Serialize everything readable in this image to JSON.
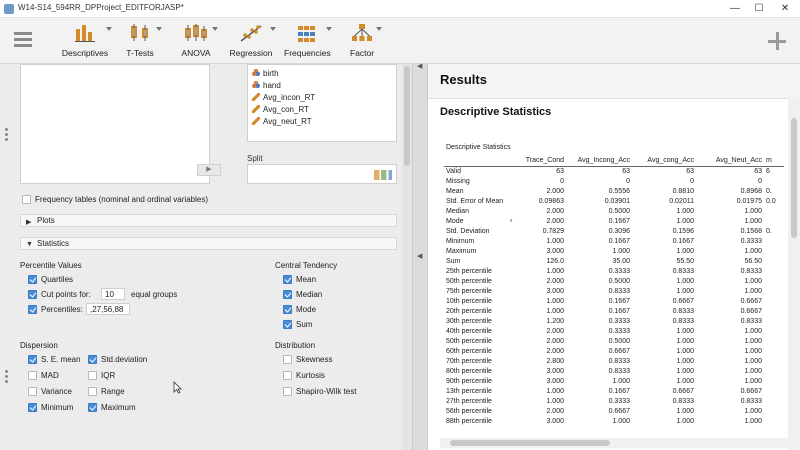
{
  "window": {
    "title": "W14-S14_594RR_DPProject_EDITFORJASP*"
  },
  "ribbon": {
    "buttons": [
      {
        "label": "Descriptives",
        "icon": "descriptives-icon"
      },
      {
        "label": "T-Tests",
        "icon": "t-tests-icon"
      },
      {
        "label": "ANOVA",
        "icon": "anova-icon"
      },
      {
        "label": "Regression",
        "icon": "regression-icon"
      },
      {
        "label": "Frequencies",
        "icon": "frequencies-icon"
      },
      {
        "label": "Factor",
        "icon": "factor-icon"
      }
    ]
  },
  "variables": [
    {
      "name": "birth",
      "type": "nominal"
    },
    {
      "name": "hand",
      "type": "nominal"
    },
    {
      "name": "Avg_incon_RT",
      "type": "scale"
    },
    {
      "name": "Avg_con_RT",
      "type": "scale"
    },
    {
      "name": "Avg_neut_RT",
      "type": "scale"
    }
  ],
  "split_label": "Split",
  "frequency_tables": {
    "label": "Frequency tables (nominal and ordinal variables)",
    "checked": false
  },
  "sections": {
    "plots": "Plots",
    "statistics": "Statistics"
  },
  "percentile_values": {
    "heading": "Percentile Values",
    "quartiles": "Quartiles",
    "cut_points_label": "Cut points for:",
    "cut_points_value": "10",
    "cut_points_suffix": "equal groups",
    "percentiles_label": "Percentiles:",
    "percentiles_value": ",27,56,88"
  },
  "central_tendency": {
    "heading": "Central Tendency",
    "items": [
      "Mean",
      "Median",
      "Mode",
      "Sum"
    ]
  },
  "dispersion": {
    "heading": "Dispersion",
    "col1": [
      {
        "label": "S. E. mean",
        "checked": true
      },
      {
        "label": "MAD",
        "checked": false
      },
      {
        "label": "Variance",
        "checked": false
      },
      {
        "label": "Minimum",
        "checked": true
      }
    ],
    "col2": [
      {
        "label": "Std.deviation",
        "checked": true
      },
      {
        "label": "IQR",
        "checked": false
      },
      {
        "label": "Range",
        "checked": false
      },
      {
        "label": "Maximum",
        "checked": true
      }
    ]
  },
  "distribution": {
    "heading": "Distribution",
    "items": [
      "Skewness",
      "Kurtosis",
      "Shapiro-Wilk test"
    ]
  },
  "results": {
    "heading": "Results",
    "analysis_title": "Descriptive Statistics",
    "table_caption": "Descriptive Statistics",
    "columns": [
      "",
      "Trace_Cond",
      "Avg_Incong_Acc",
      "Avg_cong_Acc",
      "Avg_Neut_Acc",
      "m"
    ],
    "mode_note": "ᵃ",
    "rows": [
      [
        "Valid",
        "63",
        "63",
        "63",
        "63",
        "6"
      ],
      [
        "Missing",
        "0",
        "0",
        "0",
        "0",
        ""
      ],
      [
        "Mean",
        "2.000",
        "0.5556",
        "0.8810",
        "0.8968",
        "0."
      ],
      [
        "Std. Error of Mean",
        "0.09863",
        "0.03901",
        "0.02011",
        "0.01975",
        "0.0"
      ],
      [
        "Median",
        "2.000",
        "0.5000",
        "1.000",
        "1.000",
        ""
      ],
      [
        "Mode",
        "2.000",
        "0.1667",
        "1.000",
        "1.000",
        ""
      ],
      [
        "Std. Deviation",
        "0.7829",
        "0.3096",
        "0.1596",
        "0.1568",
        "0."
      ],
      [
        "Minimum",
        "1.000",
        "0.1667",
        "0.1667",
        "0.3333",
        ""
      ],
      [
        "Maximum",
        "3.000",
        "1.000",
        "1.000",
        "1.000",
        ""
      ],
      [
        "Sum",
        "126.0",
        "35.00",
        "55.50",
        "56.50",
        ""
      ],
      [
        "25th percentile",
        "1.000",
        "0.3333",
        "0.8333",
        "0.8333",
        ""
      ],
      [
        "50th percentile",
        "2.000",
        "0.5000",
        "1.000",
        "1.000",
        ""
      ],
      [
        "75th percentile",
        "3.000",
        "0.8333",
        "1.000",
        "1.000",
        ""
      ],
      [
        "10th percentile",
        "1.000",
        "0.1667",
        "0.6667",
        "0.6667",
        ""
      ],
      [
        "20th percentile",
        "1.000",
        "0.1667",
        "0.8333",
        "0.6667",
        ""
      ],
      [
        "30th percentile",
        "1.200",
        "0.3333",
        "0.8333",
        "0.8333",
        ""
      ],
      [
        "40th percentile",
        "2.000",
        "0.3333",
        "1.000",
        "1.000",
        ""
      ],
      [
        "50th percentile",
        "2.000",
        "0.5000",
        "1.000",
        "1.000",
        ""
      ],
      [
        "60th percentile",
        "2.000",
        "0.6667",
        "1.000",
        "1.000",
        ""
      ],
      [
        "70th percentile",
        "2.800",
        "0.8333",
        "1.000",
        "1.000",
        ""
      ],
      [
        "80th percentile",
        "3.000",
        "0.8333",
        "1.000",
        "1.000",
        ""
      ],
      [
        "90th percentile",
        "3.000",
        "1.000",
        "1.000",
        "1.000",
        ""
      ],
      [
        "13th percentile",
        "1.000",
        "0.1667",
        "0.6667",
        "0.6667",
        ""
      ],
      [
        "27th percentile",
        "1.000",
        "0.3333",
        "0.8333",
        "0.8333",
        ""
      ],
      [
        "56th percentile",
        "2.000",
        "0.6667",
        "1.000",
        "1.000",
        ""
      ],
      [
        "88th percentile",
        "3.000",
        "1.000",
        "1.000",
        "1.000",
        ""
      ]
    ]
  },
  "colors": {
    "accent": "#4a8bd6",
    "panel": "#ececec"
  }
}
